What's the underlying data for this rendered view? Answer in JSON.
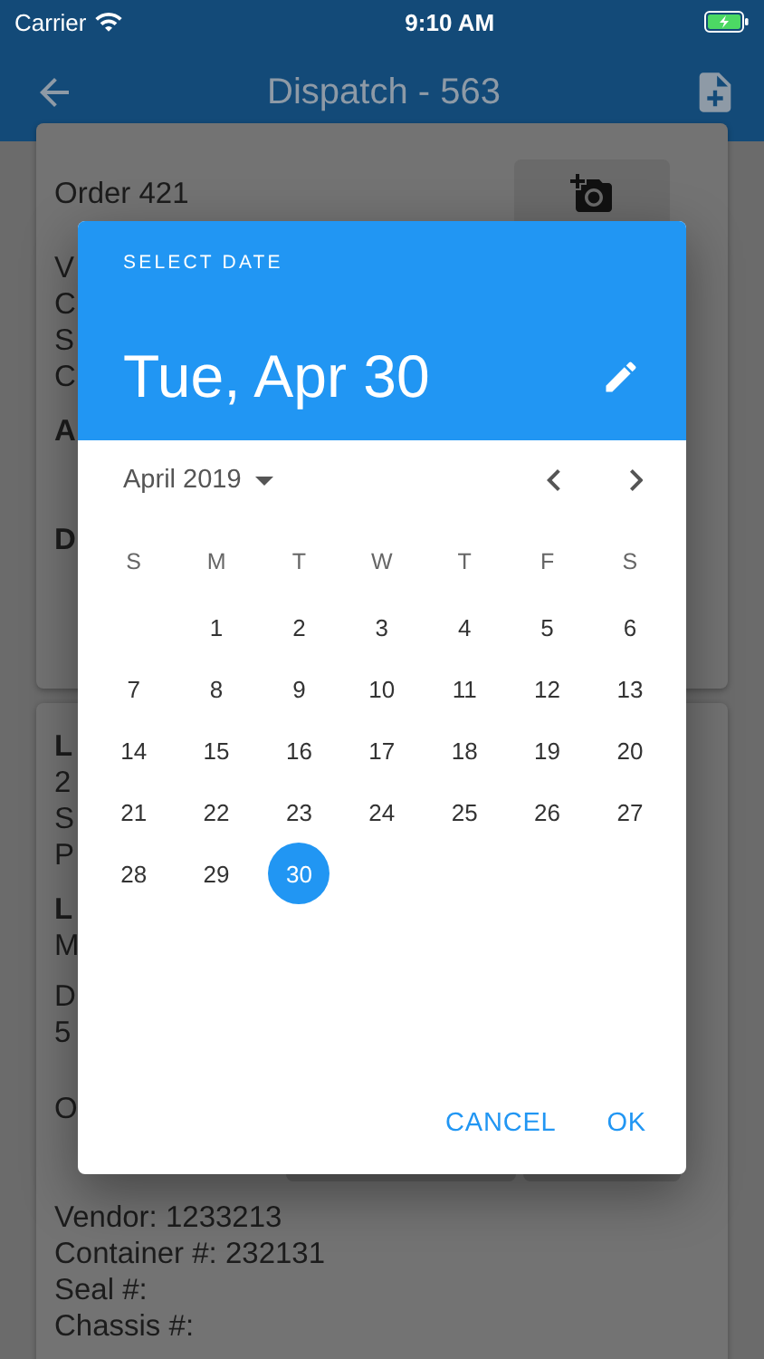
{
  "status_bar": {
    "carrier": "Carrier",
    "time": "9:10 AM"
  },
  "app_bar": {
    "title": "Dispatch - 563"
  },
  "cards": [
    {
      "header": "Order 421",
      "groups": [
        [
          {
            "text": "V",
            "bold": false
          },
          {
            "text": "C",
            "bold": false
          },
          {
            "text": "S",
            "bold": false
          },
          {
            "text": "C",
            "bold": false
          }
        ],
        [
          {
            "text": "A",
            "bold": true
          }
        ],
        [
          {
            "text": "D",
            "bold": true
          }
        ]
      ]
    },
    {
      "groups": [
        [
          {
            "text": "L",
            "bold": true
          },
          {
            "text": "2",
            "bold": false
          },
          {
            "text": "S",
            "bold": false
          },
          {
            "text": "P",
            "bold": false
          }
        ],
        [
          {
            "text": "L",
            "bold": true
          },
          {
            "text": "M",
            "bold": false
          }
        ],
        [
          {
            "text": "D",
            "bold": false
          },
          {
            "text": "5",
            "bold": false
          }
        ],
        [
          {
            "text": "O",
            "bold": false
          }
        ],
        [
          {
            "text": "Vendor: 1233213",
            "bold": false
          },
          {
            "text": "Container #: 232131",
            "bold": false
          },
          {
            "text": "Seal #:",
            "bold": false
          },
          {
            "text": "Chassis #:",
            "bold": false
          }
        ]
      ]
    }
  ],
  "date_picker": {
    "label": "SELECT DATE",
    "selected_date": "Tue, Apr 30",
    "month": "April 2019",
    "weekdays": [
      "S",
      "M",
      "T",
      "W",
      "T",
      "F",
      "S"
    ],
    "weeks": [
      [
        {
          "label": "1",
          "selected": false
        },
        {
          "label": "2",
          "selected": false
        },
        {
          "label": "3",
          "selected": false
        },
        {
          "label": "4",
          "selected": false
        },
        {
          "label": "5",
          "selected": false
        },
        {
          "label": "6",
          "selected": false
        }
      ],
      [
        {
          "label": "7",
          "selected": false
        },
        {
          "label": "8",
          "selected": false
        },
        {
          "label": "9",
          "selected": false
        },
        {
          "label": "10",
          "selected": false
        },
        {
          "label": "11",
          "selected": false
        },
        {
          "label": "12",
          "selected": false
        },
        {
          "label": "13",
          "selected": false
        }
      ],
      [
        {
          "label": "14",
          "selected": false
        },
        {
          "label": "15",
          "selected": false
        },
        {
          "label": "16",
          "selected": false
        },
        {
          "label": "17",
          "selected": false
        },
        {
          "label": "18",
          "selected": false
        },
        {
          "label": "19",
          "selected": false
        },
        {
          "label": "20",
          "selected": false
        }
      ],
      [
        {
          "label": "21",
          "selected": false
        },
        {
          "label": "22",
          "selected": false
        },
        {
          "label": "23",
          "selected": false
        },
        {
          "label": "24",
          "selected": false
        },
        {
          "label": "25",
          "selected": false
        },
        {
          "label": "26",
          "selected": false
        },
        {
          "label": "27",
          "selected": false
        }
      ],
      [
        {
          "label": "28",
          "selected": false
        },
        {
          "label": "29",
          "selected": false
        },
        {
          "label": "30",
          "selected": true
        }
      ]
    ],
    "buttons": [
      "CANCEL",
      "OK"
    ]
  }
}
